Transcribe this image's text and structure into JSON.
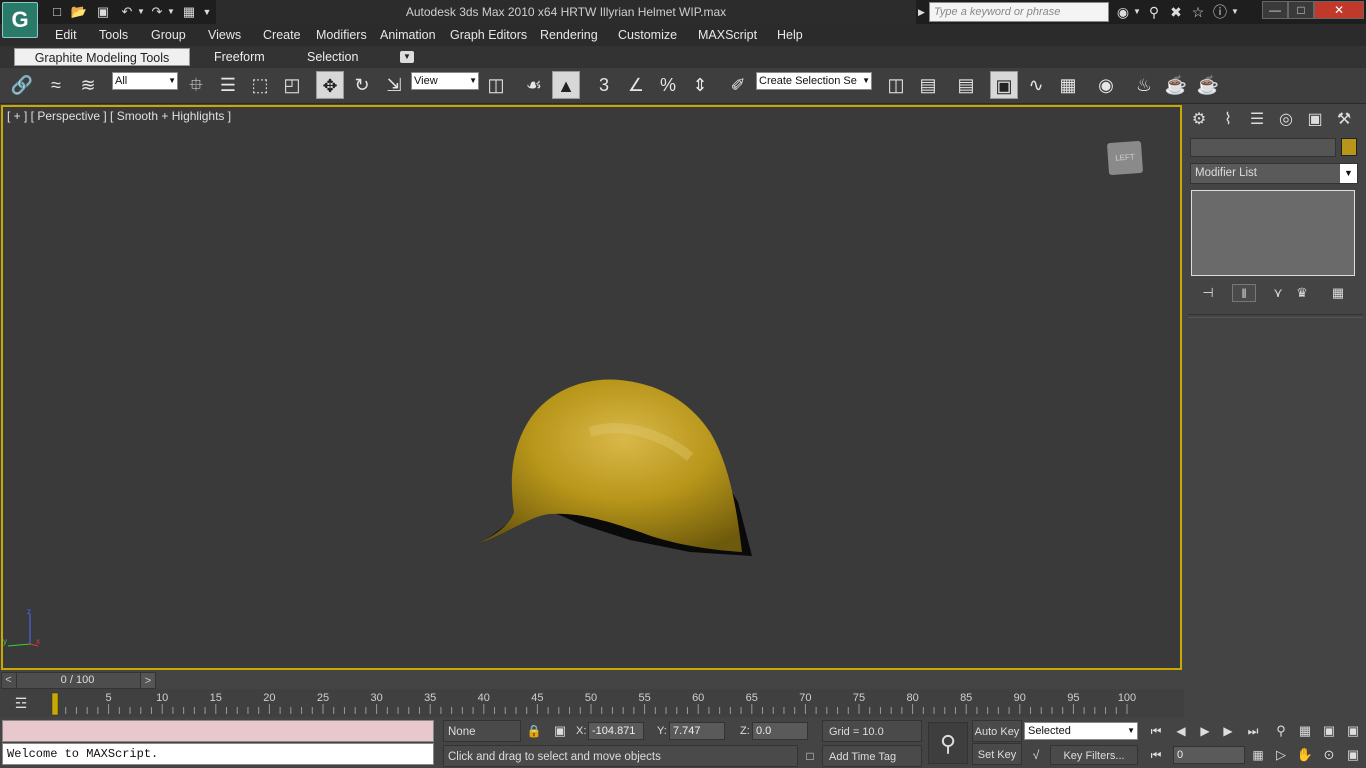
{
  "app": {
    "logo_glyph": "G",
    "title": "Autodesk 3ds Max  2010 x64        HRTW Illyrian Helmet WIP.max",
    "search_placeholder": "Type a keyword or phrase"
  },
  "menu": [
    "Edit",
    "Tools",
    "Group",
    "Views",
    "Create",
    "Modifiers",
    "Animation",
    "Graph Editors",
    "Rendering",
    "Customize",
    "MAXScript",
    "Help"
  ],
  "ribbon_tabs": [
    "Graphite Modeling Tools",
    "Freeform",
    "Selection"
  ],
  "toolbar": {
    "filter_value": "All",
    "refcoord_value": "View",
    "selection_set_value": "Create Selection Se",
    "snap_label": "3"
  },
  "viewport": {
    "label": "[ + ] [ Perspective ] [ Smooth + Highlights ]",
    "viewcube_label": "LEFT",
    "axis_z": "z",
    "axis_y": "y",
    "axis_x": "x",
    "helmet_color": "#b8961a"
  },
  "command_panel": {
    "modifier_list_label": "Modifier List",
    "object_color": "#b8961a"
  },
  "timeline": {
    "slider_text": "0 / 100",
    "prev": "<",
    "next": ">",
    "ticks": [
      "0",
      "5",
      "10",
      "15",
      "20",
      "25",
      "30",
      "35",
      "40",
      "45",
      "50",
      "55",
      "60",
      "65",
      "70",
      "75",
      "80",
      "85",
      "90",
      "95",
      "100"
    ]
  },
  "maxscript": {
    "listener_output": "Welcome to MAXScript."
  },
  "status": {
    "selection": "None Selected",
    "x_label": "X:",
    "x_value": "-104.871",
    "y_label": "Y:",
    "y_value": "7.747",
    "z_label": "Z:",
    "z_value": "0.0",
    "grid": "Grid = 10.0",
    "prompt": "Click and drag to select and move objects",
    "add_time_tag": "Add Time Tag"
  },
  "animation": {
    "auto_key": "Auto Key",
    "set_key": "Set Key",
    "key_mode_value": "Selected",
    "key_filters": "Key Filters...",
    "current_frame": "0"
  }
}
